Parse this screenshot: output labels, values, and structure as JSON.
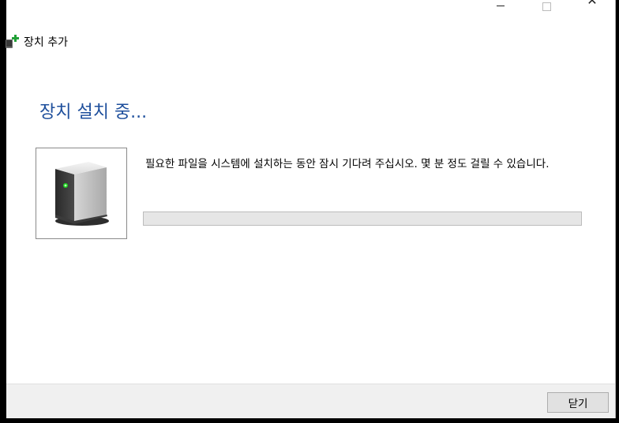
{
  "window": {
    "title": "장치 추가",
    "controls": {
      "minimize": "minimize-icon",
      "maximize": "maximize-icon",
      "close_glyph": "✕"
    }
  },
  "main": {
    "heading": "장치 설치 중...",
    "message": "필요한 파일을 시스템에 설치하는 동안 잠시 기다려 주십시오. 몇 분 정도 걸릴 수 있습니다.",
    "device_icon": "storage-device-icon",
    "progress": 0
  },
  "footer": {
    "close_label": "닫기"
  },
  "colors": {
    "heading": "#1e4f9c",
    "progress_track": "#e6e6e6",
    "footer_bg": "#f0f0f0"
  }
}
